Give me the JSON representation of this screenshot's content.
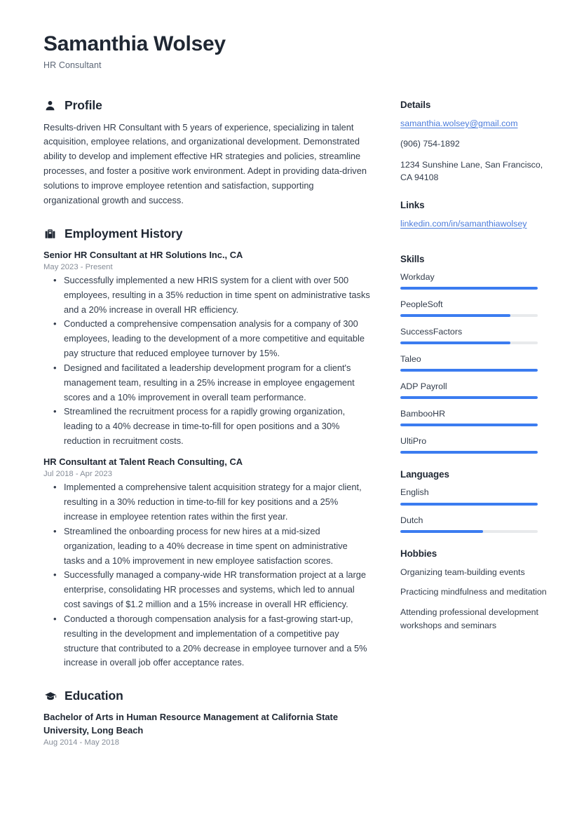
{
  "header": {
    "name": "Samanthia Wolsey",
    "job_title": "HR Consultant"
  },
  "main": {
    "profile": {
      "icon": "person-icon",
      "title": "Profile",
      "text": "Results-driven HR Consultant with 5 years of experience, specializing in talent acquisition, employee relations, and organizational development. Demonstrated ability to develop and implement effective HR strategies and policies, streamline processes, and foster a positive work environment. Adept in providing data-driven solutions to improve employee retention and satisfaction, supporting organizational growth and success."
    },
    "employment": {
      "icon": "briefcase-icon",
      "title": "Employment History",
      "entries": [
        {
          "title": "Senior HR Consultant at HR Solutions Inc., CA",
          "date": "May 2023 - Present",
          "bullets": [
            "Successfully implemented a new HRIS system for a client with over 500 employees, resulting in a 35% reduction in time spent on administrative tasks and a 20% increase in overall HR efficiency.",
            "Conducted a comprehensive compensation analysis for a company of 300 employees, leading to the development of a more competitive and equitable pay structure that reduced employee turnover by 15%.",
            "Designed and facilitated a leadership development program for a client's management team, resulting in a 25% increase in employee engagement scores and a 10% improvement in overall team performance.",
            "Streamlined the recruitment process for a rapidly growing organization, leading to a 40% decrease in time-to-fill for open positions and a 30% reduction in recruitment costs."
          ]
        },
        {
          "title": "HR Consultant at Talent Reach Consulting, CA",
          "date": "Jul 2018 - Apr 2023",
          "bullets": [
            "Implemented a comprehensive talent acquisition strategy for a major client, resulting in a 30% reduction in time-to-fill for key positions and a 25% increase in employee retention rates within the first year.",
            "Streamlined the onboarding process for new hires at a mid-sized organization, leading to a 40% decrease in time spent on administrative tasks and a 10% improvement in new employee satisfaction scores.",
            "Successfully managed a company-wide HR transformation project at a large enterprise, consolidating HR processes and systems, which led to annual cost savings of $1.2 million and a 15% increase in overall HR efficiency.",
            "Conducted a thorough compensation analysis for a fast-growing start-up, resulting in the development and implementation of a competitive pay structure that contributed to a 20% decrease in employee turnover and a 5% increase in overall job offer acceptance rates."
          ]
        }
      ]
    },
    "education": {
      "icon": "graduation-cap-icon",
      "title": "Education",
      "entries": [
        {
          "title": "Bachelor of Arts in Human Resource Management at California State University, Long Beach",
          "date": "Aug 2014 - May 2018"
        }
      ]
    }
  },
  "sidebar": {
    "details": {
      "title": "Details",
      "email": "samanthia.wolsey@gmail.com",
      "phone": "(906) 754-1892",
      "address": "1234 Sunshine Lane, San Francisco, CA 94108"
    },
    "links": {
      "title": "Links",
      "items": [
        {
          "label": "linkedin.com/in/samanthiawolsey"
        }
      ]
    },
    "skills": {
      "title": "Skills",
      "items": [
        {
          "label": "Workday",
          "level": 100
        },
        {
          "label": "PeopleSoft",
          "level": 80
        },
        {
          "label": "SuccessFactors",
          "level": 80
        },
        {
          "label": "Taleo",
          "level": 100
        },
        {
          "label": "ADP Payroll",
          "level": 100
        },
        {
          "label": "BambooHR",
          "level": 100
        },
        {
          "label": "UltiPro",
          "level": 100
        }
      ]
    },
    "languages": {
      "title": "Languages",
      "items": [
        {
          "label": "English",
          "level": 100
        },
        {
          "label": "Dutch",
          "level": 60
        }
      ]
    },
    "hobbies": {
      "title": "Hobbies",
      "items": [
        "Organizing team-building events",
        "Practicing mindfulness and meditation",
        "Attending professional development workshops and seminars"
      ]
    }
  },
  "colors": {
    "accent": "#3b7cf0",
    "link": "#4a7bdb",
    "heading": "#1f2733",
    "body_text": "#323c4b",
    "muted": "#868d98",
    "track": "#e8eaec"
  }
}
